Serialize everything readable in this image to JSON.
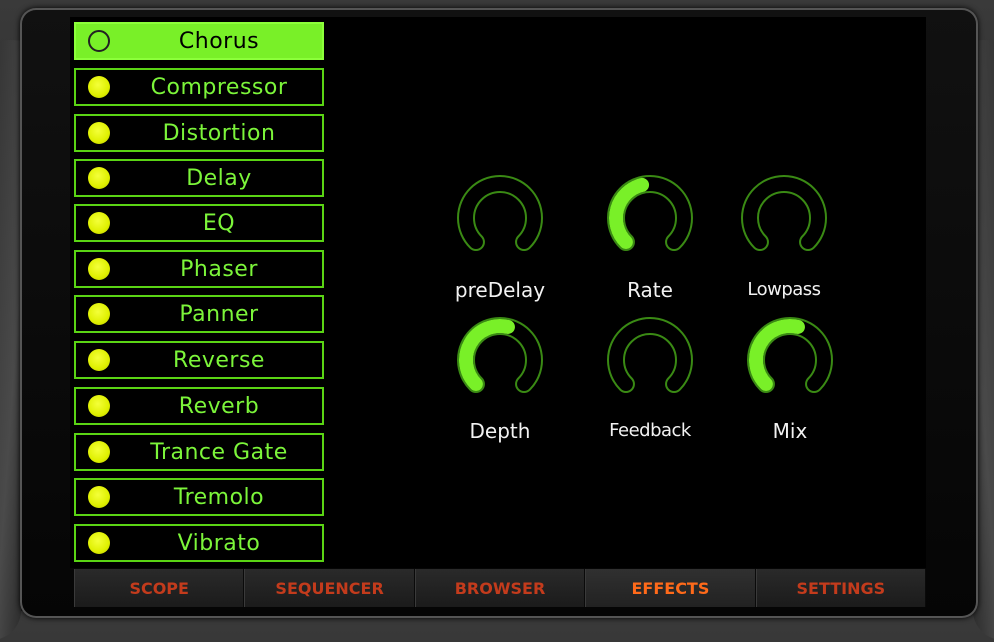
{
  "effects": {
    "items": [
      {
        "label": "Chorus",
        "active": true
      },
      {
        "label": "Compressor",
        "active": false
      },
      {
        "label": "Distortion",
        "active": false
      },
      {
        "label": "Delay",
        "active": false
      },
      {
        "label": "EQ",
        "active": false
      },
      {
        "label": "Phaser",
        "active": false
      },
      {
        "label": "Panner",
        "active": false
      },
      {
        "label": "Reverse",
        "active": false
      },
      {
        "label": "Reverb",
        "active": false
      },
      {
        "label": "Trance Gate",
        "active": false
      },
      {
        "label": "Tremolo",
        "active": false
      },
      {
        "label": "Vibrato",
        "active": false
      }
    ]
  },
  "knobs": [
    {
      "label": "preDelay",
      "value": 0.0
    },
    {
      "label": "Rate",
      "value": 0.45
    },
    {
      "label": "Lowpass",
      "value": 0.0
    },
    {
      "label": "Depth",
      "value": 0.55
    },
    {
      "label": "Feedback",
      "value": 0.0
    },
    {
      "label": "Mix",
      "value": 0.55
    }
  ],
  "tabs": [
    {
      "label": "SCOPE",
      "active": false
    },
    {
      "label": "SEQUENCER",
      "active": false
    },
    {
      "label": "BROWSER",
      "active": false
    },
    {
      "label": "EFFECTS",
      "active": true
    },
    {
      "label": "SETTINGS",
      "active": false
    }
  ],
  "colors": {
    "accent_green": "#79f028",
    "led_yellow": "#dff000",
    "tab_inactive": "#c33b1c",
    "tab_active": "#ff6a1a"
  }
}
